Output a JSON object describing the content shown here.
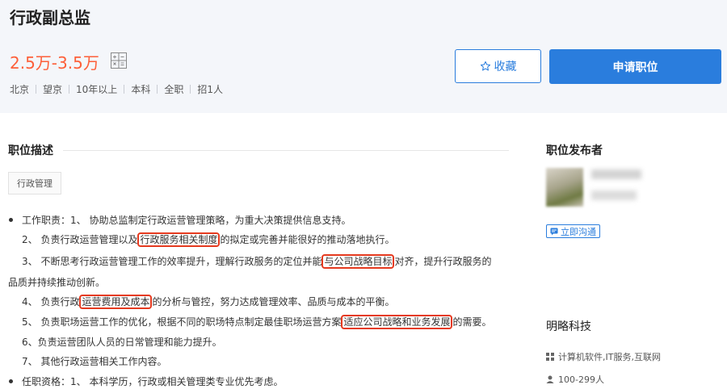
{
  "job": {
    "title": "行政副总监",
    "salary": "2.5万-3.5万",
    "tags": [
      "北京",
      "望京",
      "10年以上",
      "本科",
      "全职",
      "招1人"
    ]
  },
  "actions": {
    "favorite_label": "收藏",
    "apply_label": "申请职位"
  },
  "description": {
    "section_title": "职位描述",
    "tag": "行政管理",
    "lines": [
      {
        "pre": "工作职责：1、 协助总监制定行政运营管理策略，为重大决策提供信息支持。"
      },
      {
        "pre": "2、 负责行政运营管理以及",
        "hl": "行政服务相关制度",
        "post": "的拟定或完善并能很好的推动落地执行。"
      },
      {
        "pre": "3、 不断思考行政运营管理工作的效率提升，理解行政服务的定位并能",
        "hl": "与公司战略目标",
        "post": "对齐，提升行政服务的"
      },
      {
        "pre": "品质并持续推动创新。"
      },
      {
        "pre": "4、 负责行政",
        "hl": "运营费用及成本",
        "post": "的分析与管控，努力达成管理效率、品质与成本的平衡。"
      },
      {
        "pre": "5、 负责职场运营工作的优化，根据不同的职场特点制定最佳职场运营方案",
        "hl": "适应公司战略和业务发展",
        "post": "的需要。"
      },
      {
        "pre": "6、负责运营团队人员的日常管理和能力提升。"
      },
      {
        "pre": "7、 其他行政运营相关工作内容。"
      },
      {
        "pre": "任职资格：1、 本科学历，行政或相关管理类专业优先考虑。"
      }
    ]
  },
  "publisher": {
    "section_title": "职位发布者",
    "chat_label": "立即沟通"
  },
  "company": {
    "name": "明略科技",
    "industry": "计算机软件,IT服务,互联网",
    "size": "100-299人"
  },
  "colors": {
    "accent": "#2a7ddd",
    "salary": "#fd5f39",
    "highlight_box": "#e53a1f"
  }
}
